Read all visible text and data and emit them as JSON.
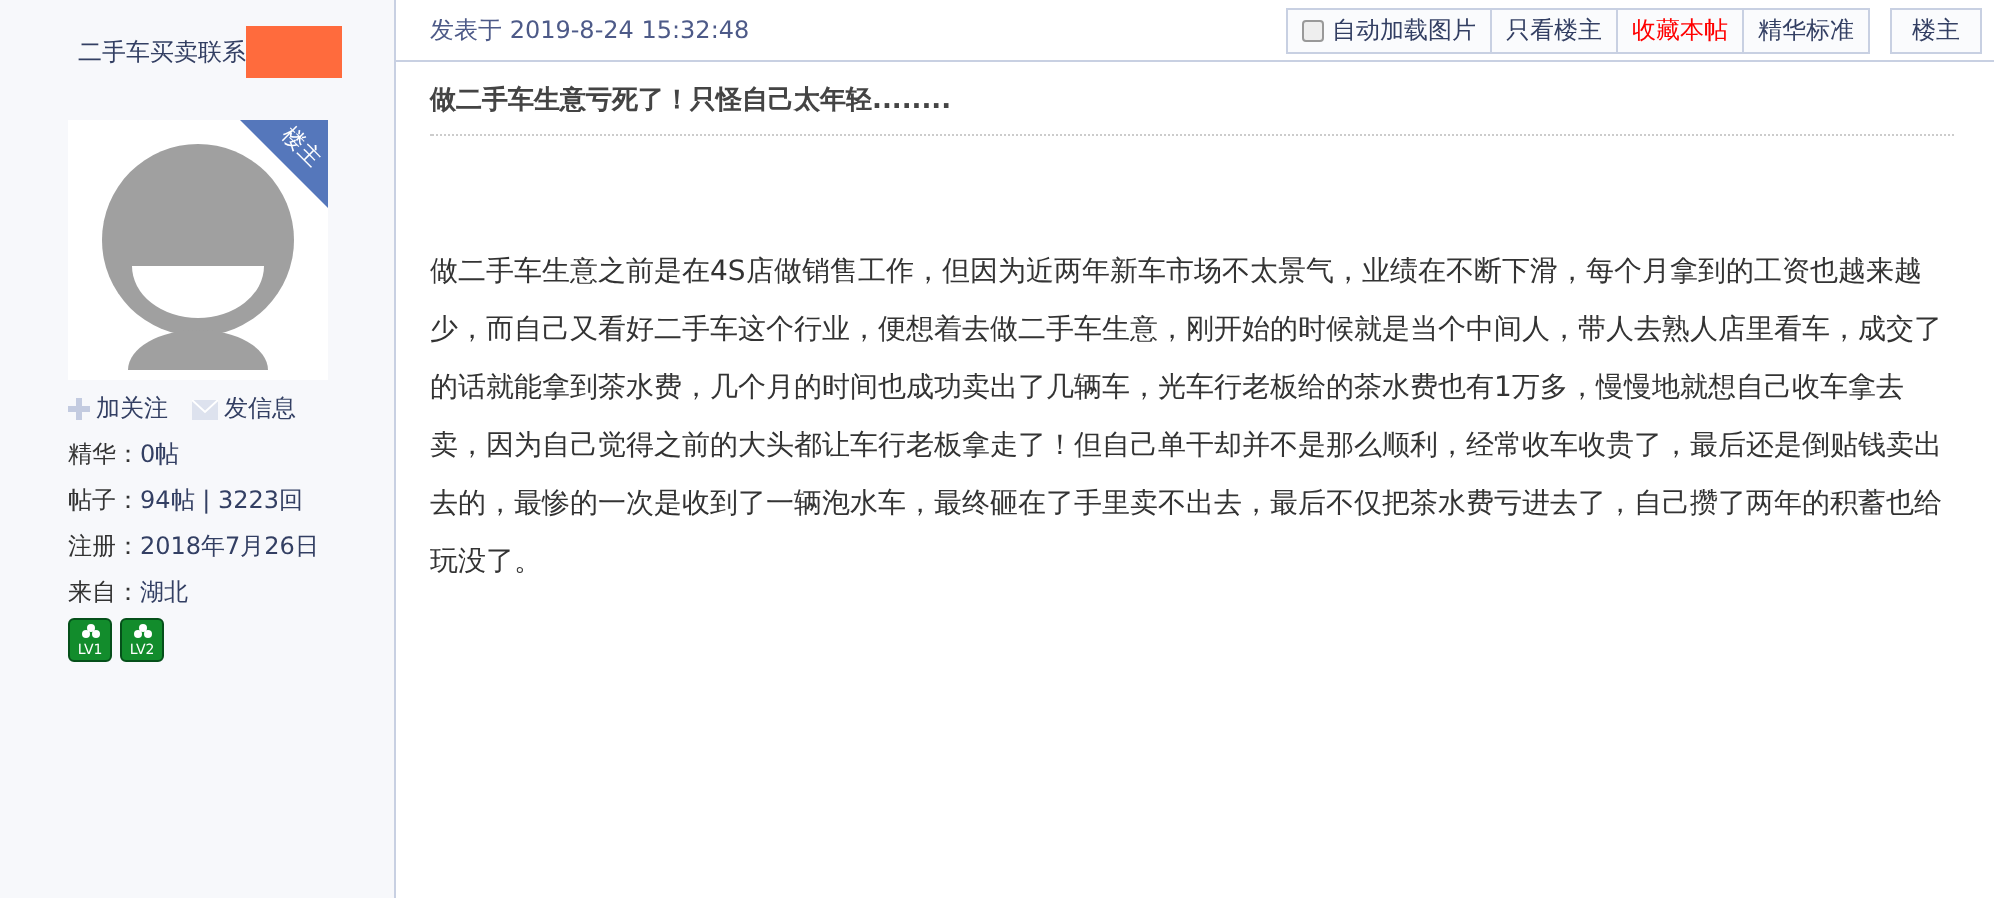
{
  "author": {
    "name": "二手车买卖联系",
    "redacted": true,
    "corner_tag": "楼主",
    "follow": "加关注",
    "message": "发信息",
    "stats": [
      {
        "label": "精华：",
        "value": "0帖"
      },
      {
        "label": "帖子：",
        "value": "94帖 | 3223回"
      },
      {
        "label": "注册：",
        "value": "2018年7月26日"
      },
      {
        "label": "来自：",
        "value": "湖北"
      }
    ],
    "badges": [
      "LV1",
      "LV2"
    ]
  },
  "post": {
    "posted": "发表于 2019-8-24 15:32:48",
    "toolbar": [
      {
        "kind": "checkbox",
        "label": "自动加载图片",
        "checked": false
      },
      {
        "kind": "link",
        "label": "只看楼主"
      },
      {
        "kind": "favorite",
        "label": "收藏本帖"
      },
      {
        "kind": "link",
        "label": "精华标准"
      }
    ],
    "floor": "楼主",
    "title": "做二手车生意亏死了！只怪自己太年轻........",
    "body": "做二手车生意之前是在4S店做销售工作，但因为近两年新车市场不太景气，业绩在不断下滑，每个月拿到的工资也越来越少，而自己又看好二手车这个行业，便想着去做二手车生意，刚开始的时候就是当个中间人，带人去熟人店里看车，成交了的话就能拿到茶水费，几个月的时间也成功卖出了几辆车，光车行老板给的茶水费也有1万多，慢慢地就想自己收车拿去卖，因为自己觉得之前的大头都让车行老板拿走了！但自己单干却并不是那么顺利，经常收车收贵了，最后还是倒贴钱卖出去的，最惨的一次是收到了一辆泡水车，最终砸在了手里卖不出去，最后不仅把茶水费亏进去了，自己攒了两年的积蓄也给玩没了。"
  }
}
